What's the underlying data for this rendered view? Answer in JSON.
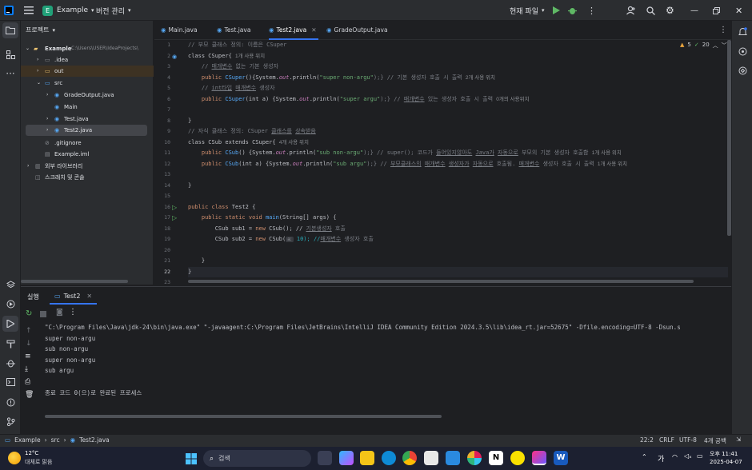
{
  "titlebar": {
    "project_name": "Example",
    "project_badge": "E",
    "vcs_label": "버전 관리",
    "current_file": "현재 파일"
  },
  "project_panel": {
    "title": "프로젝트",
    "root": "Example",
    "root_path": "C:\\Users\\USER\\IdeaProjects\\",
    "items": [
      {
        "label": ".idea"
      },
      {
        "label": "out"
      },
      {
        "label": "src"
      },
      {
        "label": "GradeOutput.java"
      },
      {
        "label": "Main"
      },
      {
        "label": "Test.java"
      },
      {
        "label": "Test2.java"
      },
      {
        "label": ".gitignore"
      },
      {
        "label": "Example.iml"
      },
      {
        "label": "외부 라이브러리"
      },
      {
        "label": "스크래치 및 콘솔"
      }
    ]
  },
  "tabs": [
    {
      "label": "Main.java"
    },
    {
      "label": "Test.java"
    },
    {
      "label": "Test2.java"
    },
    {
      "label": "GradeOutput.java"
    }
  ],
  "inspections": {
    "warnings": "5",
    "checks": "20"
  },
  "code": {
    "line_numbers": [
      "1",
      "2",
      "3",
      "4",
      "5",
      "6",
      "7",
      "8",
      "9",
      "10",
      "11",
      "12",
      "13",
      "14",
      "15",
      "16",
      "17",
      "18",
      "19",
      "20",
      "21",
      "22",
      "23"
    ],
    "l1": "// 부모 클래스 정의: 이름은 CSuper",
    "l2a": "class CSuper{",
    "l2h": "1개 사용 위치",
    "l3a": "// ",
    "l3b": "매개변수",
    "l3c": " 없는 기본 생성자",
    "l4a": "public ",
    "l4b": "CSuper",
    "l4c": "(){System.",
    "l4d": "out",
    "l4e": ".println(",
    "l4f": "\"super non-argu\"",
    "l4g": ");} // 기본 생성자 호출 시 출력",
    "l4h": "2개 사용 위치",
    "l5a": "// ",
    "l5b": "int타입",
    "l5c": " ",
    "l5d": "매개변수",
    "l5e": " 생성자",
    "l6a": "public ",
    "l6b": "CSuper",
    "l6c": "(int a) {System.",
    "l6d": "out",
    "l6e": ".println(",
    "l6f": "\"super argu\"",
    "l6g": ");} // ",
    "l6h": "매개변수",
    "l6i": " 있는 생성자 호출 시 출력",
    "l6j": "0개의 사용위치",
    "l8": "}",
    "l9a": "// 자식 클래스 정의: CSuper ",
    "l9b": "클래스를",
    "l9c": " ",
    "l9d": "상속받음",
    "l10a": "class CSub extends CSuper{",
    "l10h": "4개 사용 위치",
    "l11a": "public ",
    "l11b": "CSub",
    "l11c": "() {System.",
    "l11d": "out",
    "l11e": ".println(",
    "l11f": "\"sub non-argu\"",
    "l11g": ");} // super(); 코드가 ",
    "l11h": "들어있지않아도",
    "l11i": " ",
    "l11j": "Java가",
    "l11k": " ",
    "l11l": "자동으로",
    "l11m": " 부모의 기본 생성자 호출함",
    "l11n": "1개 사용 위치",
    "l12a": "public ",
    "l12b": "CSub",
    "l12c": "(int a) {System.",
    "l12d": "out",
    "l12e": ".println(",
    "l12f": "\"sub argu\"",
    "l12g": ");} // ",
    "l12h": "부모클래스의",
    "l12i": " ",
    "l12j": "매개변수",
    "l12k": " ",
    "l12l": "생성자가",
    "l12m": " ",
    "l12n": "자동으로",
    "l12o": " 호출됨. ",
    "l12p": "매개변수",
    "l12q": " 생성자 호출 시 출력",
    "l12r": "1개 사용 위치",
    "l14": "}",
    "l16a": "public class ",
    "l16b": "Test2 {",
    "l17a": "public static void ",
    "l17b": "main",
    "l17c": "(String[] args) {",
    "l18a": "CSub sub1 = ",
    "l18b": "new ",
    "l18c": "CSub(); // ",
    "l18d": "기본생성자",
    "l18e": " 호출",
    "l19a": "CSub sub2 = ",
    "l19b": "new ",
    "l19c": "CSub(",
    "l19d": "a:",
    "l19e": " 10); //",
    "l19f": "매개변수",
    "l19g": " 생성자 호출",
    "l21": "}",
    "l22": "}"
  },
  "run": {
    "tool_label": "실행",
    "tab_label": "Test2",
    "command": "\"C:\\Program Files\\Java\\jdk-24\\bin\\java.exe\" \"-javaagent:C:\\Program Files\\JetBrains\\IntelliJ IDEA Community Edition 2024.3.5\\lib\\idea_rt.jar=52675\" -Dfile.encoding=UTF-8 -Dsun.s",
    "lines": [
      "super non-argu",
      "sub non-argu",
      "super non-argu",
      "sub argu"
    ],
    "exit": "종료 코드 0(으)로 완료된 프로세스"
  },
  "status": {
    "crumb1": "Example",
    "crumb2": "src",
    "crumb3": "Test2.java",
    "position": "22:2",
    "line_sep": "CRLF",
    "encoding": "UTF-8",
    "indent": "4개 공백"
  },
  "taskbar": {
    "temp": "12°C",
    "weather": "대체로 맑음",
    "search": "검색",
    "ime": "가",
    "time": "오후 11:41",
    "date": "2025-04-07"
  },
  "colors": {
    "accent": "#3574f0",
    "keyword": "#cf8e6d",
    "string": "#6aab73",
    "function": "#56a8f5",
    "comment": "#7a7e85"
  }
}
